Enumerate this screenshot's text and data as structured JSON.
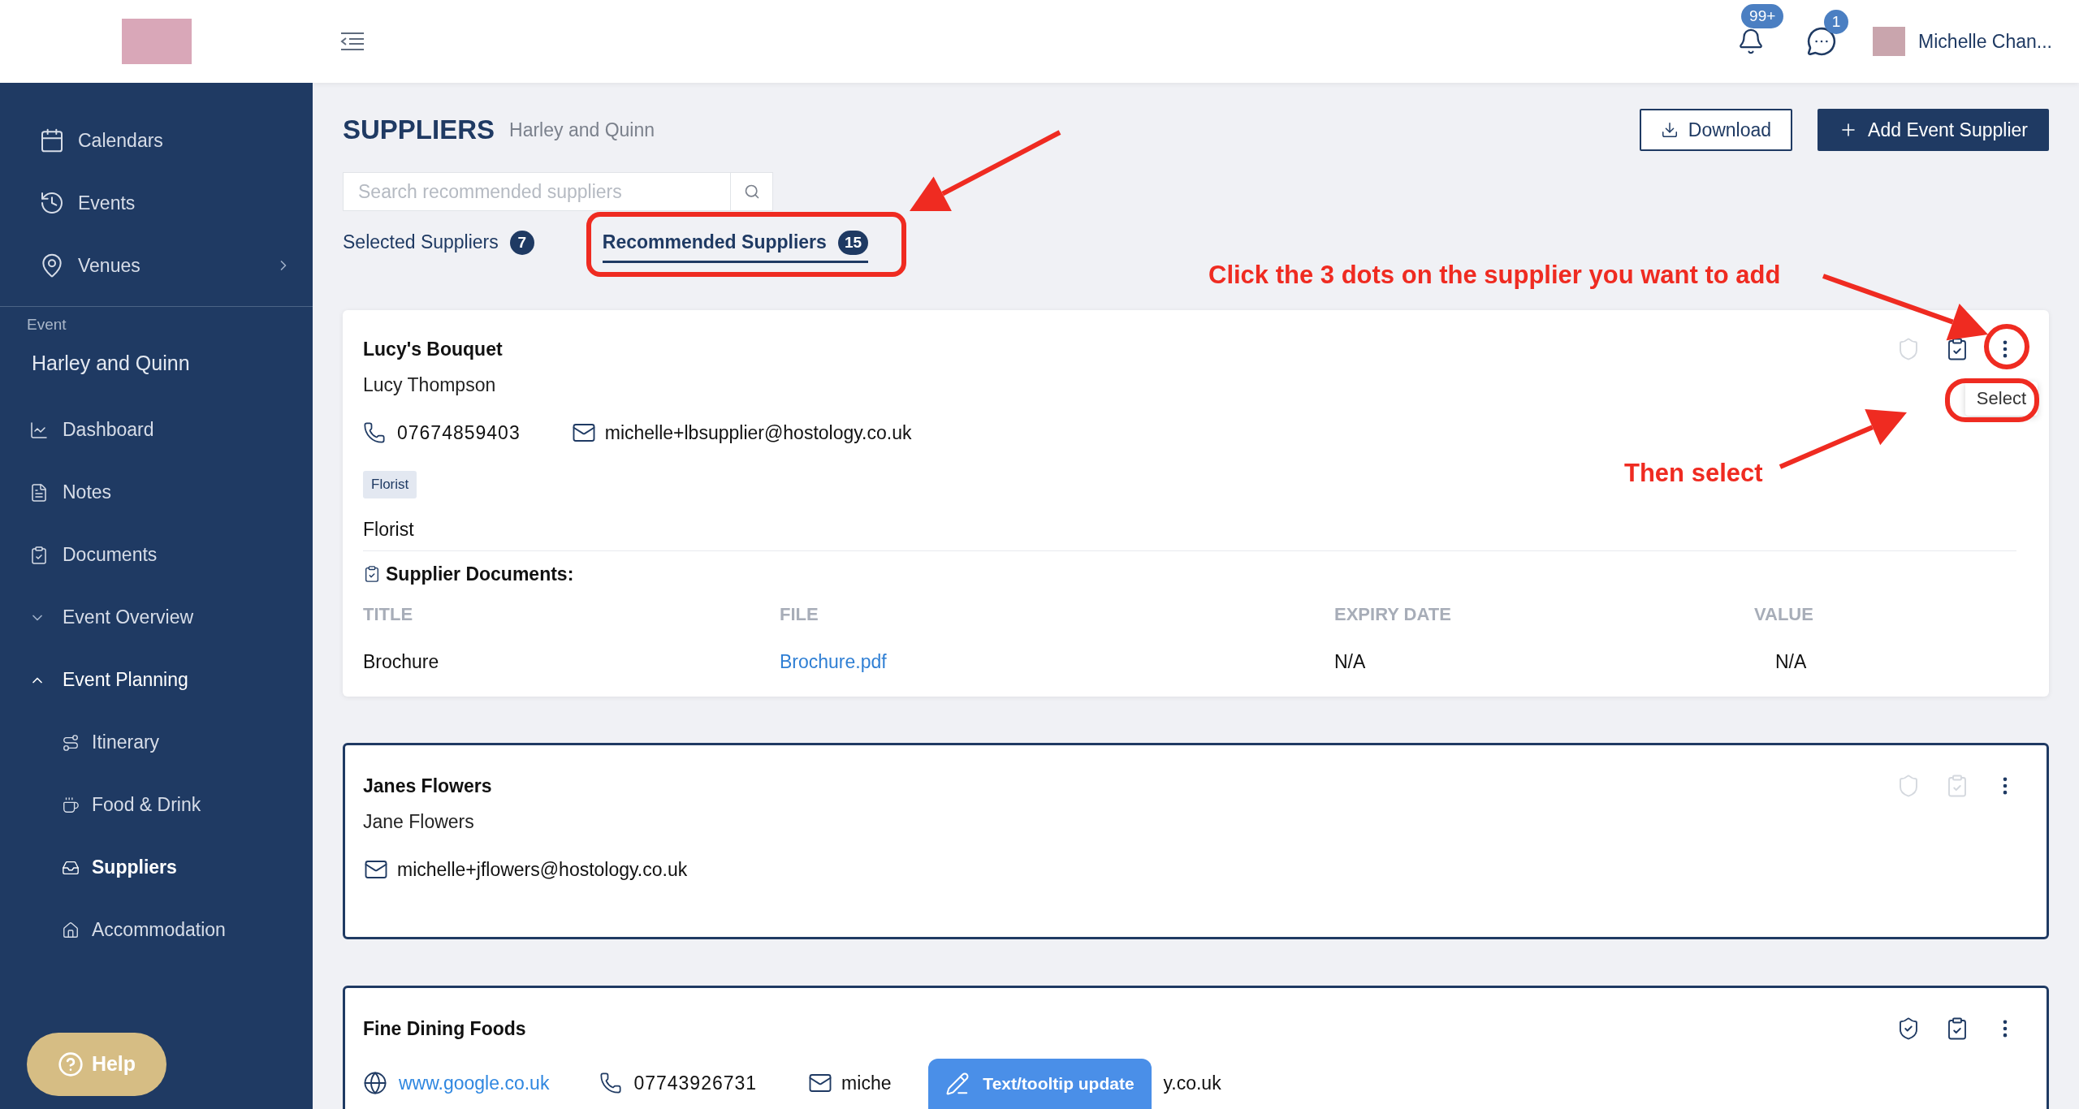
{
  "sidebar": {
    "nav": [
      {
        "label": "Calendars",
        "has_submenu": false
      },
      {
        "label": "Events",
        "has_submenu": false
      },
      {
        "label": "Venues",
        "has_submenu": true
      }
    ],
    "section_label": "Event",
    "event_name": "Harley and Quinn",
    "event_items": [
      {
        "label": "Dashboard",
        "kind": "link",
        "selected": false
      },
      {
        "label": "Notes",
        "kind": "link",
        "selected": false
      },
      {
        "label": "Documents",
        "kind": "link",
        "selected": false
      },
      {
        "label": "Event Overview",
        "kind": "group",
        "expanded": false,
        "selected": false
      },
      {
        "label": "Event Planning",
        "kind": "group",
        "expanded": true,
        "selected": false,
        "children": [
          {
            "label": "Itinerary",
            "selected": false
          },
          {
            "label": "Food & Drink",
            "selected": false
          },
          {
            "label": "Suppliers",
            "selected": true
          },
          {
            "label": "Accommodation",
            "selected": false
          }
        ]
      }
    ],
    "help": "Help"
  },
  "header": {
    "notifications": "99+",
    "messages": "1",
    "user": "Michelle Chan..."
  },
  "page": {
    "title": "SUPPLIERS",
    "subtitle": "Harley and Quinn",
    "buttons": [
      "Download",
      "Add Event Supplier"
    ],
    "search": {
      "placeholder": "Search recommended suppliers"
    },
    "tabs": [
      {
        "label": "Selected Suppliers",
        "count": "7",
        "selected": false
      },
      {
        "label": "Recommended Suppliers",
        "count": "15",
        "selected": true
      }
    ]
  },
  "suppliers": [
    {
      "name": "Lucy's Bouquet",
      "contact": "Lucy Thompson",
      "phone": "07674859403",
      "email": "michelle+lbsupplier@hostology.co.uk",
      "tags": [
        "Florist"
      ],
      "category": "Florist",
      "outlined": false,
      "verified": false,
      "has_documents": true,
      "menu_open": true,
      "menu_item": "Select",
      "documents": {
        "heading": "Supplier Documents:",
        "columns": [
          "TITLE",
          "FILE",
          "EXPIRY DATE",
          "VALUE"
        ],
        "rows": [
          [
            "Brochure",
            "Brochure.pdf",
            "N/A",
            "N/A"
          ]
        ]
      }
    },
    {
      "name": "Janes Flowers",
      "contact": "Jane Flowers",
      "email": "michelle+jflowers@hostology.co.uk",
      "outlined": true,
      "verified": false,
      "has_documents": false,
      "menu_open": false
    },
    {
      "name": "Fine Dining Foods",
      "website": "www.google.co.uk",
      "phone": "07743926731",
      "email": "miche",
      "email_tail": "y.co.uk",
      "outlined": true,
      "verified": true,
      "has_documents": true,
      "menu_open": false
    }
  ],
  "floating_button": "Text/tooltip update",
  "annotations": [
    "Click the 3 dots on the supplier you want to add",
    "Then select"
  ]
}
